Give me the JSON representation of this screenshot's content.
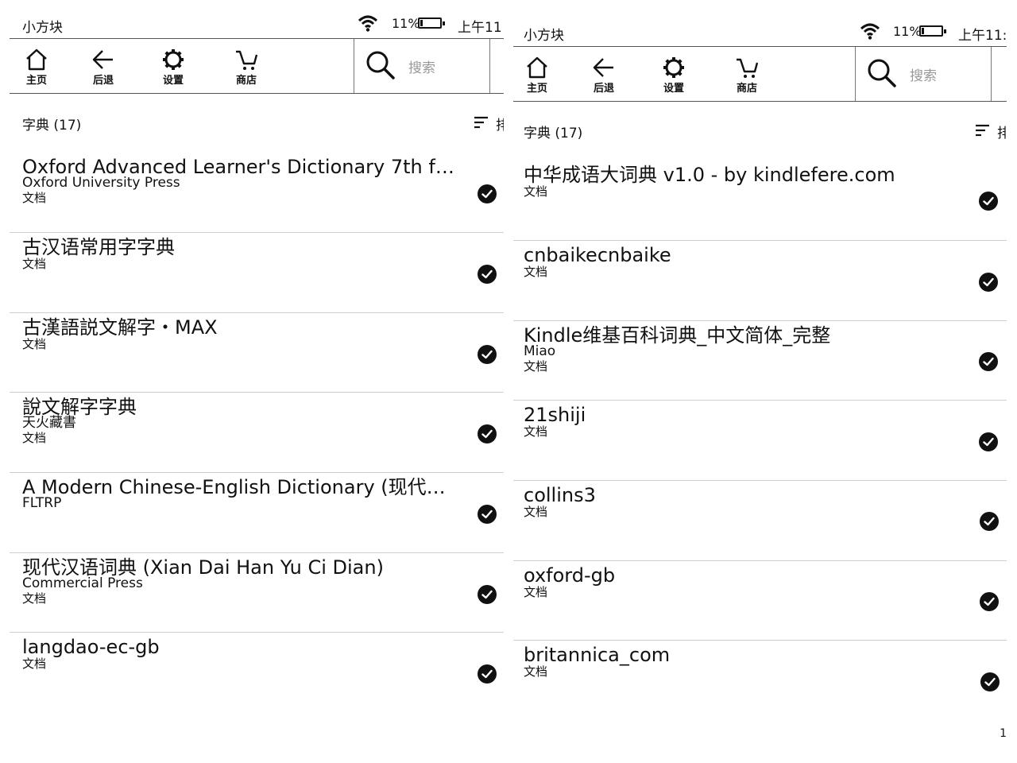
{
  "panels": [
    {
      "carrier": "小方块",
      "battery_pct": "11%",
      "clock": "上午11",
      "toolbar": {
        "home": "主页",
        "back": "后退",
        "settings": "设置",
        "store": "商店",
        "search_placeholder": "搜索"
      },
      "section_label": "字典 (17)",
      "sort_label": "排",
      "items": [
        {
          "title": "Oxford Advanced Learner's Dictionary 7th f…",
          "subtitle": "Oxford University Press",
          "type": "文档"
        },
        {
          "title": "古汉语常用字字典",
          "subtitle": "",
          "type": "文档"
        },
        {
          "title": "古漢語説文解字・MAX",
          "subtitle": "",
          "type": "文档"
        },
        {
          "title": "說文解字字典",
          "subtitle": "天火藏書",
          "type": "文档"
        },
        {
          "title": "A Modern Chinese-English Dictionary (现代…",
          "subtitle": "FLTRP",
          "type": ""
        },
        {
          "title": "现代汉语词典 (Xian Dai Han Yu Ci Dian)",
          "subtitle": "Commercial Press",
          "type": "文档"
        },
        {
          "title": "langdao-ec-gb",
          "subtitle": "",
          "type": "文档"
        }
      ]
    },
    {
      "carrier": "小方块",
      "battery_pct": "11%",
      "clock": "上午11:",
      "toolbar": {
        "home": "主页",
        "back": "后退",
        "settings": "设置",
        "store": "商店",
        "search_placeholder": "搜索"
      },
      "section_label": "字典 (17)",
      "sort_label": "排",
      "edge_mark": "1",
      "items": [
        {
          "title": "中华成语大词典 v1.0 - by kindlefere.com",
          "subtitle": "",
          "type": "文档"
        },
        {
          "title": "cnbaikecnbaike",
          "subtitle": "",
          "type": "文档"
        },
        {
          "title": "Kindle维基百科词典_中文简体_完整",
          "subtitle": "Miao",
          "type": "文档"
        },
        {
          "title": "21shiji",
          "subtitle": "",
          "type": "文档"
        },
        {
          "title": "collins3",
          "subtitle": "",
          "type": "文档"
        },
        {
          "title": "oxford-gb",
          "subtitle": "",
          "type": "文档"
        },
        {
          "title": "britannica_com",
          "subtitle": "",
          "type": "文档"
        }
      ]
    }
  ]
}
